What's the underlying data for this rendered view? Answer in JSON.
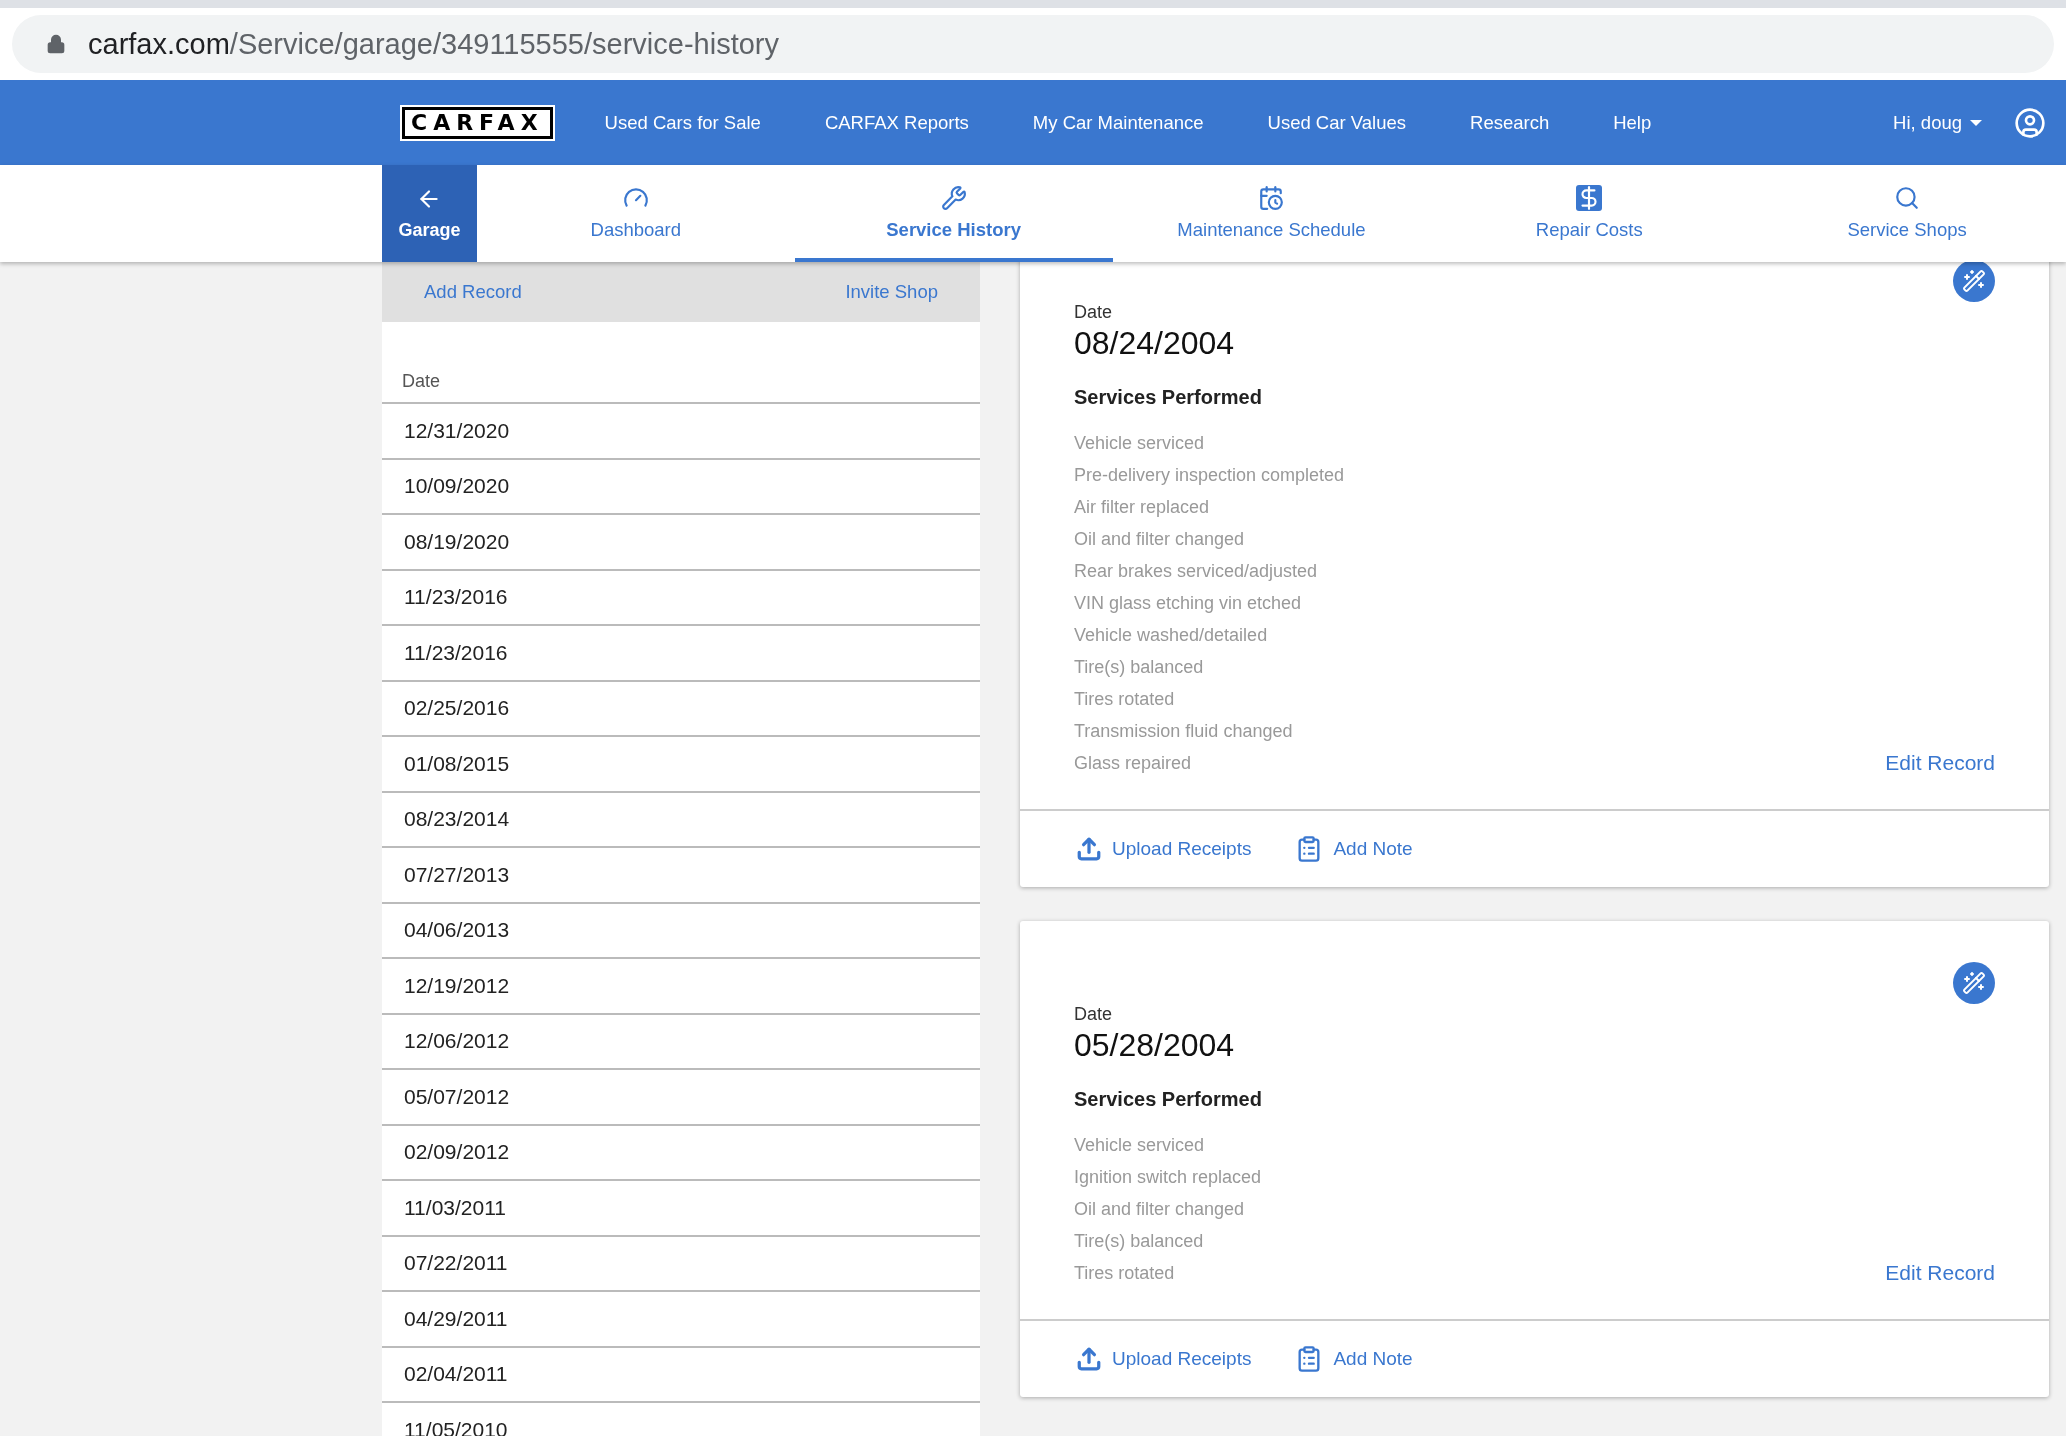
{
  "browser": {
    "url_host": "carfax.com",
    "url_path": "/Service/garage/349115555/service-history"
  },
  "nav": {
    "logo": "CARFAX",
    "links": [
      "Used Cars for Sale",
      "CARFAX Reports",
      "My Car Maintenance",
      "Used Car Values",
      "Research",
      "Help"
    ],
    "user": "Hi, doug"
  },
  "back_button": {
    "label": "Garage"
  },
  "tabs": [
    {
      "label": "Dashboard",
      "kind": "gauge",
      "selected": false
    },
    {
      "label": "Service History",
      "kind": "tools",
      "selected": true
    },
    {
      "label": "Maintenance Schedule",
      "kind": "calendar",
      "selected": false
    },
    {
      "label": "Repair Costs",
      "kind": "dollar",
      "selected": false
    },
    {
      "label": "Service Shops",
      "kind": "search",
      "selected": false
    }
  ],
  "record_list": {
    "actions": [
      "Add Record",
      "Invite Shop"
    ],
    "column": "Date",
    "rows": [
      "12/31/2020",
      "10/09/2020",
      "08/19/2020",
      "11/23/2016",
      "11/23/2016",
      "02/25/2016",
      "01/08/2015",
      "08/23/2014",
      "07/27/2013",
      "04/06/2013",
      "12/19/2012",
      "12/06/2012",
      "05/07/2012",
      "02/09/2012",
      "11/03/2011",
      "07/22/2011",
      "04/29/2011",
      "02/04/2011",
      "11/05/2010"
    ]
  },
  "records": [
    {
      "date_label": "Date",
      "date": "08/24/2004",
      "services_title": "Services Performed",
      "services": [
        "Vehicle serviced",
        "Pre-delivery inspection completed",
        "Air filter replaced",
        "Oil and filter changed",
        "Rear brakes serviced/adjusted",
        "VIN glass etching vin etched",
        "Vehicle washed/detailed",
        "Tire(s) balanced",
        "Tires rotated",
        "Transmission fluid changed",
        "Glass repaired"
      ],
      "edit": "Edit Record",
      "upload": "Upload Receipts",
      "note": "Add Note"
    },
    {
      "date_label": "Date",
      "date": "05/28/2004",
      "services_title": "Services Performed",
      "services": [
        "Vehicle serviced",
        "Ignition switch replaced",
        "Oil and filter changed",
        "Tire(s) balanced",
        "Tires rotated"
      ],
      "edit": "Edit Record",
      "upload": "Upload Receipts",
      "note": "Add Note"
    }
  ]
}
